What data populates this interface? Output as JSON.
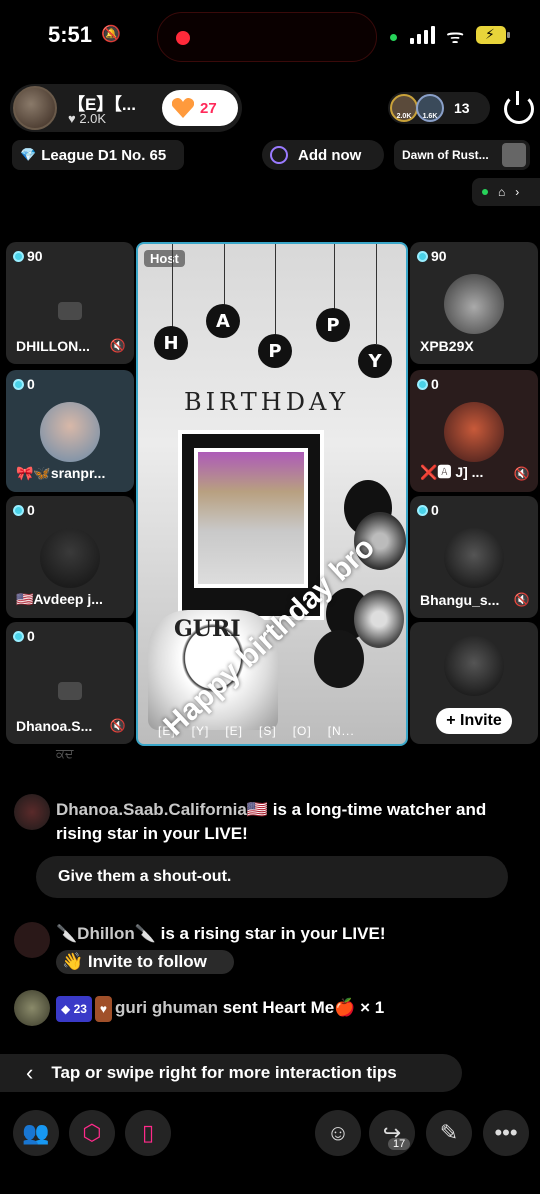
{
  "status_bar": {
    "time": "5:51"
  },
  "host": {
    "name": "【E】【...",
    "likes": "2.0K",
    "heart_count": "27"
  },
  "viewers": {
    "avatar1_label": "2.0K",
    "avatar2_label": "1.6K",
    "count": "13"
  },
  "badges": {
    "league": "League D1 No. 65",
    "add_now": "Add now",
    "event": "Dawn of Rust..."
  },
  "host_tile": {
    "label": "Host",
    "letters": [
      "H",
      "A",
      "P",
      "P",
      "Y"
    ],
    "birthday": "BIRTHDAY",
    "cake_text": "GURI",
    "bottom_names": [
      "[E]",
      "[Y]",
      "[E]",
      "[S]",
      "[O]",
      "[N..."
    ],
    "watermark": "Happy birthday bro"
  },
  "guests": [
    {
      "score": "90",
      "name": "DHILLON..."
    },
    {
      "score": "0",
      "name": "🎀🦋sranpr..."
    },
    {
      "score": "0",
      "name": "🇺🇸Avdeep j..."
    },
    {
      "score": "0",
      "name": "Dhanoa.S..."
    },
    {
      "score": "90",
      "name": "XPB29X"
    },
    {
      "score": "0",
      "name": "❌🅰 J] ..."
    },
    {
      "score": "0",
      "name": "Bhangu_s..."
    }
  ],
  "invite_label": "+ Invite",
  "chat": {
    "faded": "ਕਦ",
    "msg1_user": "Dhanoa.Saab.California🇺🇸",
    "msg1_text": " is a long-time watcher and rising star in your LIVE!",
    "shoutout": "Give them a shout-out.",
    "msg2_user": "🔪Dhillon🔪",
    "msg2_text": " is a rising star in your LIVE!",
    "follow_chip": "👋 Invite to follow",
    "msg3_level": "23",
    "msg3_user": "guri ghuman",
    "msg3_text": " sent Heart Me🍎 × 1",
    "tip": "Tap or swipe right for more interaction tips"
  },
  "toolbar": {
    "share_count": "17"
  },
  "colors": {
    "accent_pink": "#ff2a8a",
    "host_border": "#3aa6c8",
    "record_red": "#ff2a3a"
  }
}
